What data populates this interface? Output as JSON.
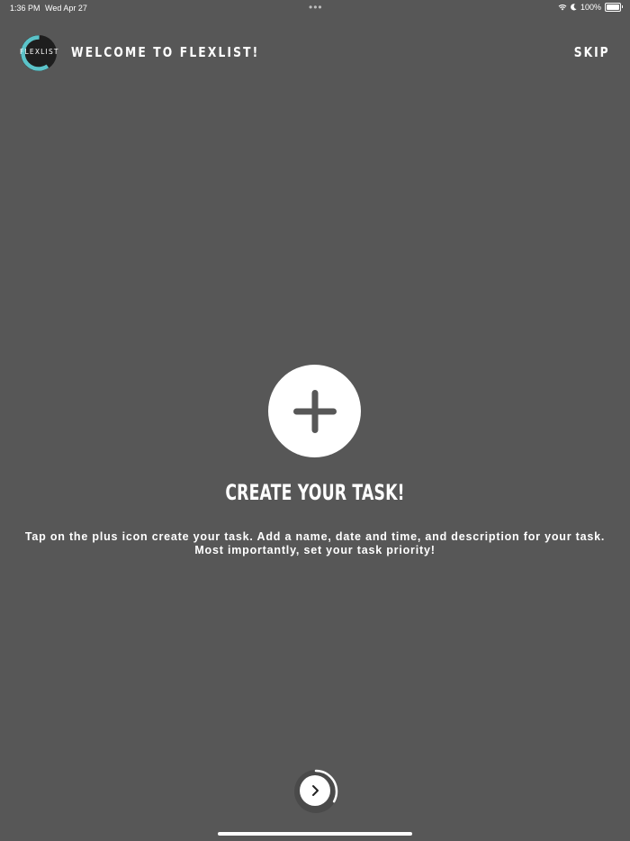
{
  "status_bar": {
    "time": "1:36 PM",
    "date": "Wed Apr 27",
    "battery": "100%",
    "icons": [
      "wifi-icon",
      "moon-icon",
      "battery-icon"
    ]
  },
  "header": {
    "logo_text": "FLEXLIST",
    "title": "WELCOME TO FLEXLIST!",
    "skip_label": "SKIP"
  },
  "onboarding": {
    "title": "CREATE YOUR TASK!",
    "description": "Tap on the plus icon create your task. Add a name, date and time, and description for your task. Most importantly, set your task priority!",
    "step_progress": 0.33
  },
  "colors": {
    "background": "#575757",
    "accent": "#5bc3c9",
    "foreground": "#ffffff"
  }
}
